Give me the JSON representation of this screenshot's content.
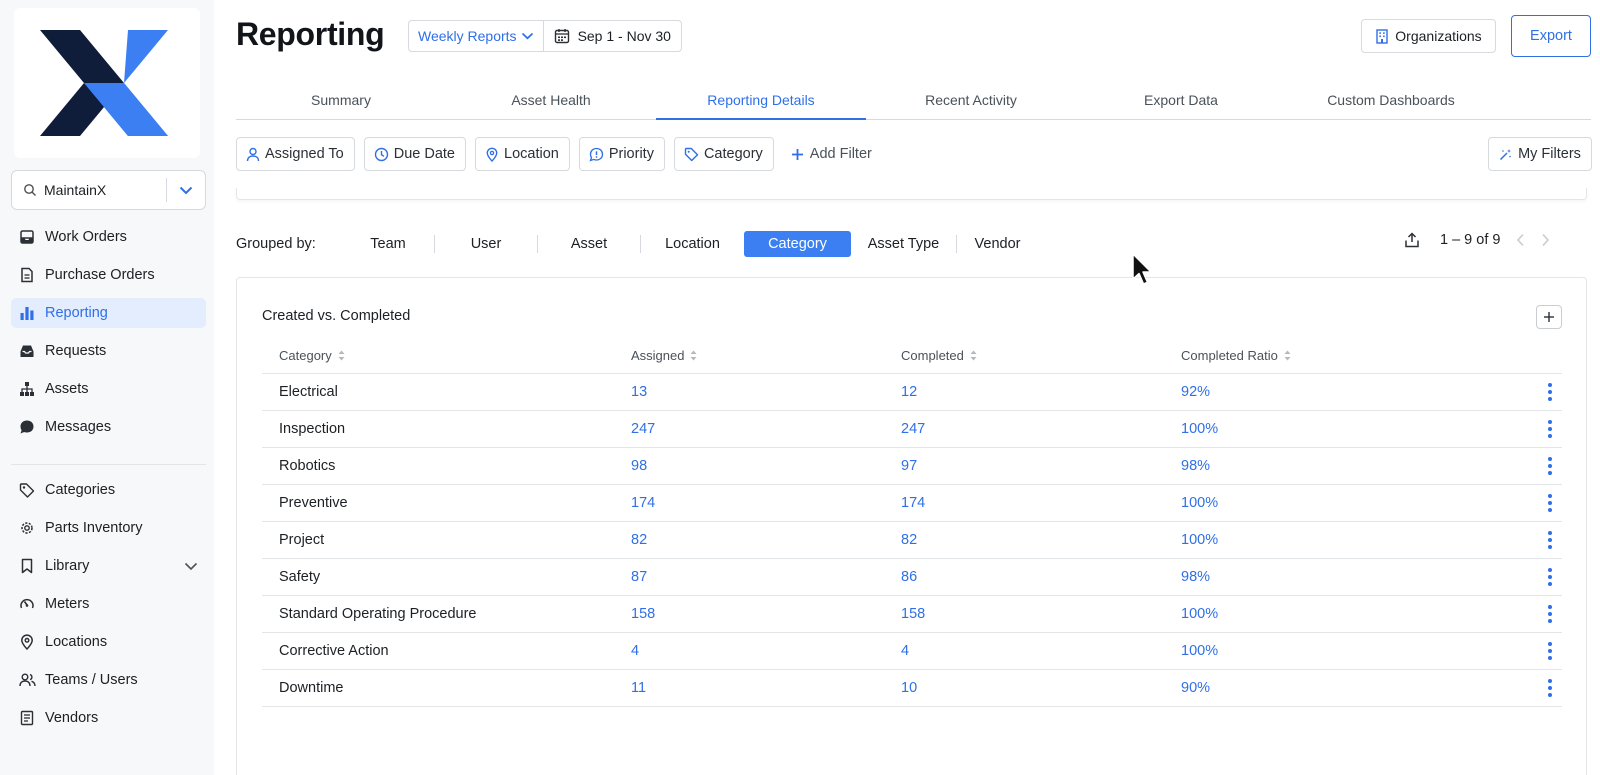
{
  "brand": {
    "colors": {
      "accent": "#2f6fe8",
      "logo_dark": "#0f1c3a",
      "logo_blue": "#3b7ff2"
    }
  },
  "sidebar": {
    "org_name": "MaintainX",
    "items_main": [
      {
        "label": "Work Orders",
        "icon": "work-orders-icon",
        "active": false
      },
      {
        "label": "Purchase Orders",
        "icon": "purchase-orders-icon",
        "active": false
      },
      {
        "label": "Reporting",
        "icon": "bar-chart-icon",
        "active": true
      },
      {
        "label": "Requests",
        "icon": "inbox-icon",
        "active": false
      },
      {
        "label": "Assets",
        "icon": "hierarchy-icon",
        "active": false
      },
      {
        "label": "Messages",
        "icon": "chat-bubble-icon",
        "active": false
      }
    ],
    "items_secondary": [
      {
        "label": "Categories",
        "icon": "tag-icon"
      },
      {
        "label": "Parts Inventory",
        "icon": "gear-icon"
      },
      {
        "label": "Library",
        "icon": "bookmark-icon",
        "expandable": true
      },
      {
        "label": "Meters",
        "icon": "gauge-icon"
      },
      {
        "label": "Locations",
        "icon": "map-pin-icon"
      },
      {
        "label": "Teams / Users",
        "icon": "users-icon"
      },
      {
        "label": "Vendors",
        "icon": "vendor-list-icon"
      }
    ]
  },
  "header": {
    "title": "Reporting",
    "report_type": "Weekly Reports",
    "date_range": "Sep 1 - Nov 30",
    "organizations_label": "Organizations",
    "export_label": "Export"
  },
  "tabs": [
    {
      "label": "Summary",
      "active": false
    },
    {
      "label": "Asset Health",
      "active": false
    },
    {
      "label": "Reporting Details",
      "active": true
    },
    {
      "label": "Recent Activity",
      "active": false
    },
    {
      "label": "Export Data",
      "active": false
    },
    {
      "label": "Custom Dashboards",
      "active": false
    }
  ],
  "filters": {
    "chips": [
      {
        "label": "Assigned To",
        "icon": "user-icon"
      },
      {
        "label": "Due Date",
        "icon": "clock-icon"
      },
      {
        "label": "Location",
        "icon": "map-pin-icon"
      },
      {
        "label": "Priority",
        "icon": "priority-icon"
      },
      {
        "label": "Category",
        "icon": "tag-icon"
      }
    ],
    "add_filter_label": "Add Filter",
    "my_filters_label": "My Filters"
  },
  "group_by": {
    "label": "Grouped by:",
    "options": [
      {
        "label": "Team",
        "active": false
      },
      {
        "label": "User",
        "active": false
      },
      {
        "label": "Asset",
        "active": false
      },
      {
        "label": "Location",
        "active": false
      },
      {
        "label": "Category",
        "active": true
      },
      {
        "label": "Asset Type",
        "active": false
      },
      {
        "label": "Vendor",
        "active": false
      }
    ],
    "pagination": "1 – 9 of 9"
  },
  "card": {
    "title": "Created vs. Completed",
    "columns": [
      "Category",
      "Assigned",
      "Completed",
      "Completed Ratio"
    ],
    "rows": [
      {
        "category": "Electrical",
        "assigned": "13",
        "completed": "12",
        "ratio": "92%"
      },
      {
        "category": "Inspection",
        "assigned": "247",
        "completed": "247",
        "ratio": "100%"
      },
      {
        "category": "Robotics",
        "assigned": "98",
        "completed": "97",
        "ratio": "98%"
      },
      {
        "category": "Preventive",
        "assigned": "174",
        "completed": "174",
        "ratio": "100%"
      },
      {
        "category": "Project",
        "assigned": "82",
        "completed": "82",
        "ratio": "100%"
      },
      {
        "category": "Safety",
        "assigned": "87",
        "completed": "86",
        "ratio": "98%"
      },
      {
        "category": "Standard Operating Procedure",
        "assigned": "158",
        "completed": "158",
        "ratio": "100%"
      },
      {
        "category": "Corrective Action",
        "assigned": "4",
        "completed": "4",
        "ratio": "100%"
      },
      {
        "category": "Downtime",
        "assigned": "11",
        "completed": "10",
        "ratio": "90%"
      }
    ]
  }
}
